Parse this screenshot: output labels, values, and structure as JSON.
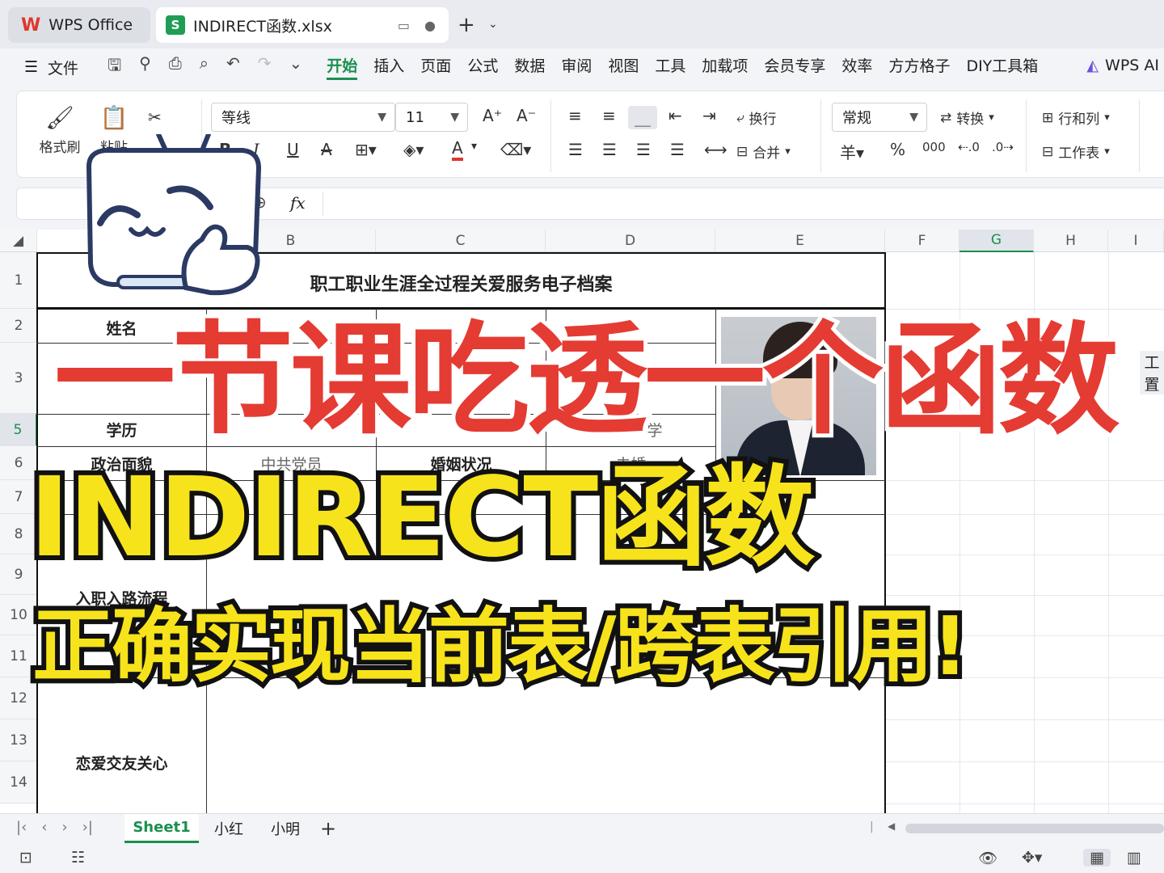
{
  "titlebar": {
    "app_tab": "WPS Office",
    "file_tab": "INDIRECT函数.xlsx"
  },
  "menu": {
    "file_label": "文件",
    "items": [
      "开始",
      "插入",
      "页面",
      "公式",
      "数据",
      "审阅",
      "视图",
      "工具",
      "加载项",
      "会员专享",
      "效率",
      "方方格子",
      "DIY工具箱"
    ],
    "active": "开始",
    "ai_label": "WPS AI"
  },
  "ribbon": {
    "format_painter": "格式刷",
    "paste": "粘贴",
    "font_name": "等线",
    "font_size": "11",
    "wrap": "换行",
    "merge": "合并",
    "number_format": "常规",
    "convert": "转换",
    "rows_cols": "行和列",
    "worksheet": "工作表",
    "bold": "B",
    "italic": "I",
    "underline": "U",
    "currency": "羊",
    "percent": "%",
    "thousands": "000"
  },
  "formula": {
    "fx": "fx"
  },
  "columns": [
    "B",
    "C",
    "D",
    "E",
    "F",
    "G",
    "H",
    "I"
  ],
  "selected_column": "G",
  "rows": [
    "1",
    "2",
    "3",
    "5",
    "6",
    "7",
    "8",
    "9",
    "10",
    "11",
    "12",
    "13",
    "14"
  ],
  "selected_row": "5",
  "cells": {
    "title": "职工职业生涯全过程关爱服务电子档案",
    "name_label": "姓名",
    "education_label": "学历",
    "education_value_partial": "学",
    "political_label": "政治面貌",
    "political_value": "中共党员",
    "marital_label": "婚姻状况",
    "marital_value": "未婚",
    "onboarding_label": "入职入路流程",
    "dating_label": "恋爱交友关心",
    "g3_partial": "工置"
  },
  "sheet_tabs": [
    "Sheet1",
    "小红",
    "小明"
  ],
  "active_sheet": "Sheet1",
  "overlay": {
    "line1": "一节课吃透一个函数",
    "line2": "INDIRECT函数",
    "line3": "正确实现当前表/跨表引用!"
  },
  "colors": {
    "accent": "#1a8f4e",
    "overlay_red": "#e43b33",
    "overlay_yellow": "#f7e31b",
    "wps_red": "#e0362a"
  }
}
